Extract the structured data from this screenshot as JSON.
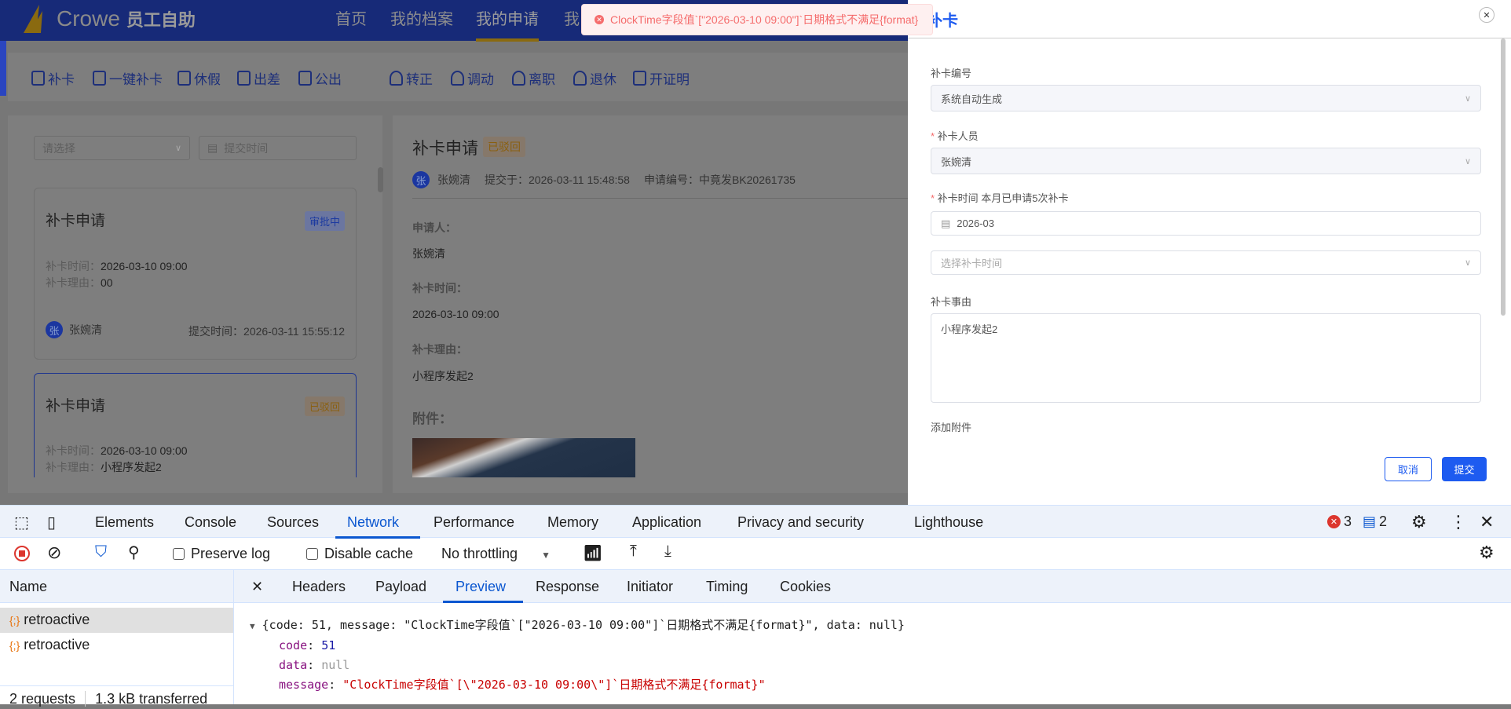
{
  "header": {
    "brand": "Crowe",
    "brand_sub": "员工自助",
    "nav": [
      "首页",
      "我的档案",
      "我的申请",
      "我"
    ]
  },
  "toast": {
    "message": "ClockTime字段值`[\"2026-03-10 09:00\"]`日期格式不满足{format}"
  },
  "toolbar": [
    "补卡",
    "一键补卡",
    "休假",
    "出差",
    "公出",
    "转正",
    "调动",
    "离职",
    "退休",
    "开证明"
  ],
  "filters": {
    "select_placeholder": "请选择",
    "date_placeholder": "提交时间"
  },
  "cards": [
    {
      "title": "补卡申请",
      "status": "审批中",
      "time_label": "补卡时间：",
      "time": "2026-03-10 09:00",
      "reason_label": "补卡理由：",
      "reason": "00",
      "avatar": "张",
      "user": "张婉清",
      "submitted": "提交时间：2026-03-11 15:55:12"
    },
    {
      "title": "补卡申请",
      "status": "已驳回",
      "time_label": "补卡时间：",
      "time": "2026-03-10 09:00",
      "reason_label": "补卡理由：",
      "reason": "小程序发起2"
    }
  ],
  "detail": {
    "title": "补卡申请",
    "status": "已驳回",
    "avatar": "张",
    "user": "张婉清",
    "submitted": "提交于：2026-03-11 15:48:58",
    "number": "申请编号：中竟发BK20261735",
    "applicant_label": "申请人：",
    "applicant": "张婉清",
    "time_label": "补卡时间：",
    "time": "2026-03-10 09:00",
    "reason_label": "补卡理由：",
    "reason": "小程序发起2",
    "attachment_label": "附件："
  },
  "drawer": {
    "title": "补卡",
    "fields": {
      "number_label": "补卡编号",
      "number_value": "系统自动生成",
      "person_label": "补卡人员",
      "person_value": "张婉清",
      "time_label": "补卡时间 本月已申请5次补卡",
      "month_value": "2026-03",
      "time_placeholder": "选择补卡时间",
      "reason_label": "补卡事由",
      "reason_value": "小程序发起2",
      "attach_label": "添加附件"
    },
    "cancel": "取消",
    "submit": "提交"
  },
  "devtools": {
    "tabs": [
      "Elements",
      "Console",
      "Sources",
      "Network",
      "Performance",
      "Memory",
      "Application",
      "Privacy and security",
      "Lighthouse"
    ],
    "errors": "3",
    "messages": "2",
    "preserve_log": "Preserve log",
    "disable_cache": "Disable cache",
    "throttling": "No throttling",
    "name_header": "Name",
    "requests": [
      "retroactive",
      "retroactive"
    ],
    "detail_tabs": [
      "Headers",
      "Payload",
      "Preview",
      "Response",
      "Initiator",
      "Timing",
      "Cookies"
    ],
    "summary": [
      "2 requests",
      "1.3 kB transferred"
    ],
    "preview": {
      "summary": "{code: 51, message: \"ClockTime字段值`[\"2026-03-10 09:00\"]`日期格式不满足{format}\", data: null}",
      "code_key": "code",
      "code_val": "51",
      "data_key": "data",
      "data_val": "null",
      "message_key": "message",
      "message_val": "\"ClockTime字段值`[\\\"2026-03-10 09:00\\\"]`日期格式不满足{format}\""
    }
  },
  "colors": {
    "accent": "#1d5bf0",
    "error": "#f56c6c",
    "devtools_accent": "#0b57d0"
  }
}
